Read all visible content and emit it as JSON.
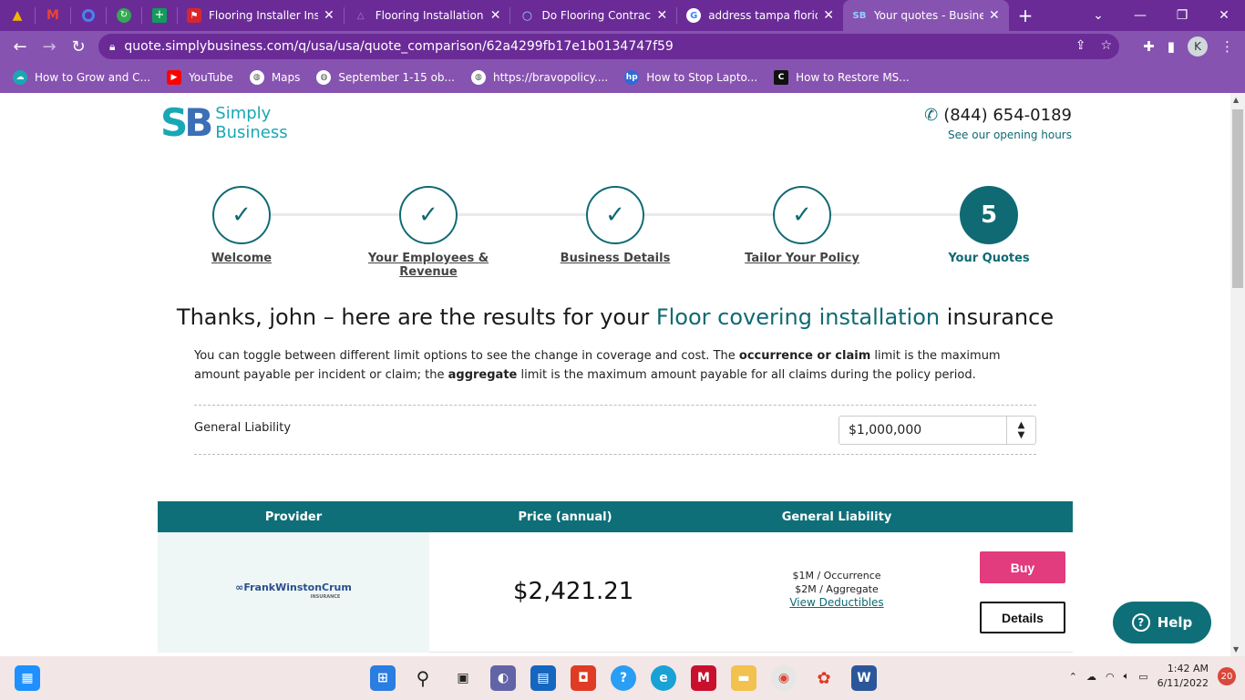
{
  "browser": {
    "pinned_tabs": [
      {
        "icon": "google-drive-icon",
        "color": "#f4b400"
      },
      {
        "icon": "gmail-icon",
        "color": "#ea4335"
      },
      {
        "icon": "circle-app-icon",
        "color": "#4285f4"
      },
      {
        "icon": "refresh-app-icon",
        "color": "#34a853"
      },
      {
        "icon": "sheets-plus-icon",
        "color": "#0f9d58"
      }
    ],
    "tabs": [
      {
        "title": "Flooring Installer Insu",
        "active": false
      },
      {
        "title": "Flooring Installation C",
        "active": false
      },
      {
        "title": "Do Flooring Contracto",
        "active": false
      },
      {
        "title": "address tampa florida",
        "active": false
      },
      {
        "title": "Your quotes - Busines",
        "active": true
      }
    ],
    "url": "quote.simplybusiness.com/q/usa/usa/quote_comparison/62a4299fb17e1b0134747f59",
    "profile_initial": "K",
    "bookmarks": [
      {
        "label": "How to Grow and C...",
        "color": "#1aa7b5"
      },
      {
        "label": "YouTube",
        "color": "#ff0000"
      },
      {
        "label": "Maps",
        "color": "#ffffff"
      },
      {
        "label": "September 1-15 ob...",
        "color": "#ffffff"
      },
      {
        "label": "https://bravopolicy....",
        "color": "#ffffff"
      },
      {
        "label": "How to Stop Lapto...",
        "color": "#2f6ad8"
      },
      {
        "label": "How to Restore MS...",
        "color": "#111111"
      }
    ]
  },
  "header": {
    "logo_mark_1": "S",
    "logo_mark_2": "B",
    "logo_line1": "Simply",
    "logo_line2": "Business",
    "phone": "(844) 654-0189",
    "hours_link": "See our opening hours"
  },
  "steps": [
    {
      "label": "Welcome",
      "done": true
    },
    {
      "label": "Your Employees & Revenue",
      "done": true
    },
    {
      "label": "Business Details",
      "done": true
    },
    {
      "label": "Tailor Your Policy",
      "done": true
    },
    {
      "label": "Your Quotes",
      "number": "5",
      "done": false
    }
  ],
  "heading": {
    "prefix": "Thanks, john – here are the results for your ",
    "highlight": "Floor covering installation",
    "suffix": " insurance"
  },
  "intro": {
    "part1": "You can toggle between different limit options to see the change in coverage and cost. The ",
    "bold1": "occurrence or claim",
    "part2": " limit is the maximum amount payable per incident or claim; the ",
    "bold2": "aggregate",
    "part3": " limit is the maximum amount payable for all claims during the policy period."
  },
  "limit": {
    "label": "General Liability",
    "selected": "$1,000,000"
  },
  "table": {
    "headers": [
      "Provider",
      "Price (annual)",
      "General Liability"
    ],
    "rows": [
      {
        "provider": "FrankWinstonCrum",
        "provider_sub": "INSURANCE",
        "price": "$2,421.21",
        "occurrence": "$1M / Occurrence",
        "aggregate": "$2M / Aggregate",
        "deductibles_link": "View Deductibles",
        "buy_label": "Buy",
        "details_label": "Details"
      }
    ]
  },
  "help_label": "Help",
  "taskbar": {
    "time": "1:42 AM",
    "date": "6/11/2022",
    "notifications": "20"
  }
}
